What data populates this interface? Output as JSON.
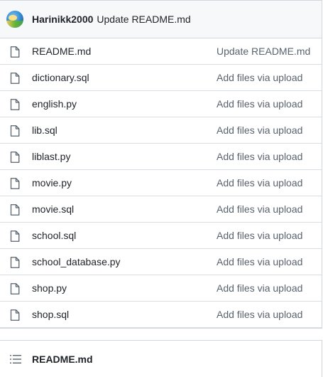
{
  "commit": {
    "author": "Harinikk2000",
    "message": "Update README.md",
    "avatar_icon": "user-avatar"
  },
  "files": [
    {
      "name": "README.md",
      "commit": "Update README.md",
      "icon": "file-icon"
    },
    {
      "name": "dictionary.sql",
      "commit": "Add files via upload",
      "icon": "file-icon"
    },
    {
      "name": "english.py",
      "commit": "Add files via upload",
      "icon": "file-icon"
    },
    {
      "name": "lib.sql",
      "commit": "Add files via upload",
      "icon": "file-icon"
    },
    {
      "name": "liblast.py",
      "commit": "Add files via upload",
      "icon": "file-icon"
    },
    {
      "name": "movie.py",
      "commit": "Add files via upload",
      "icon": "file-icon"
    },
    {
      "name": "movie.sql",
      "commit": "Add files via upload",
      "icon": "file-icon"
    },
    {
      "name": "school.sql",
      "commit": "Add files via upload",
      "icon": "file-icon"
    },
    {
      "name": "school_database.py",
      "commit": "Add files via upload",
      "icon": "file-icon"
    },
    {
      "name": "shop.py",
      "commit": "Add files via upload",
      "icon": "file-icon"
    },
    {
      "name": "shop.sql",
      "commit": "Add files via upload",
      "icon": "file-icon"
    }
  ],
  "readme": {
    "title": "README.md",
    "icon": "list-unordered-icon"
  }
}
